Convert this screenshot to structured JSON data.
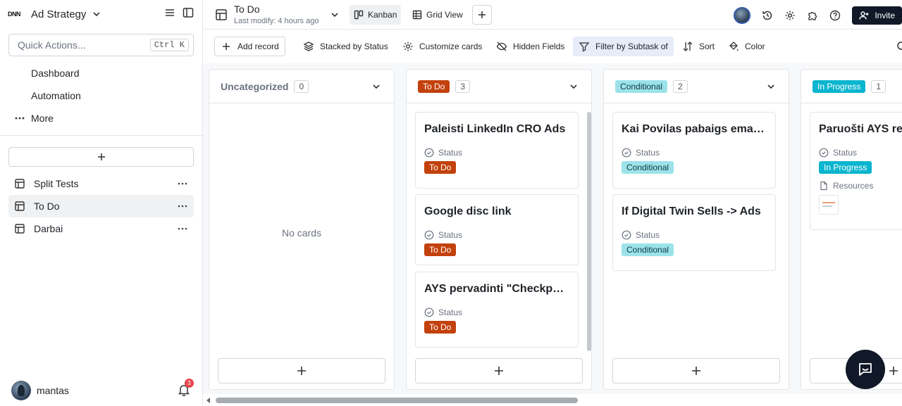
{
  "workspace": {
    "logo_text": "DNN",
    "name": "Ad Strategy"
  },
  "quick_actions": {
    "placeholder": "Quick Actions...",
    "shortcut": "Ctrl K"
  },
  "nav": [
    {
      "label": "Dashboard",
      "icon": "dashboard-icon"
    },
    {
      "label": "Automation",
      "icon": "automation-icon"
    },
    {
      "label": "More",
      "icon": "more-horizontal-icon"
    }
  ],
  "tables": [
    {
      "label": "Split Tests",
      "active": false
    },
    {
      "label": "To Do",
      "active": true
    },
    {
      "label": "Darbai",
      "active": false
    }
  ],
  "user": {
    "name": "mantas",
    "notifications": "3"
  },
  "header": {
    "title": "To Do",
    "subtitle": "Last modify: 4 hours ago"
  },
  "views": [
    {
      "label": "Kanban",
      "active": true
    },
    {
      "label": "Grid View",
      "active": false
    }
  ],
  "invite_label": "Invite",
  "toolbar": {
    "add_record": "Add record",
    "stacked": "Stacked by Status",
    "customize": "Customize cards",
    "hidden": "Hidden Fields",
    "filter": "Filter by Subtask of",
    "sort": "Sort",
    "color": "Color"
  },
  "columns": [
    {
      "title": "Uncategorized",
      "count": "0",
      "empty_text": "No cards",
      "cards": []
    },
    {
      "title": "To Do",
      "count": "3",
      "cards": [
        {
          "title": "Paleisti LinkedIn CRO Ads",
          "field": "Status",
          "value": "To Do"
        },
        {
          "title": "Google disc link",
          "field": "Status",
          "value": "To Do"
        },
        {
          "title": "AYS pervadinti \"Checkpoint\"",
          "field": "Status",
          "value": "To Do"
        }
      ]
    },
    {
      "title": "Conditional",
      "count": "2",
      "cards": [
        {
          "title": "Kai Povilas pabaigs email sekas",
          "field": "Status",
          "value": "Conditional"
        },
        {
          "title": "If Digital Twin Sells -> Ads",
          "field": "Status",
          "value": "Conditional"
        }
      ]
    },
    {
      "title": "In Progress",
      "count": "1",
      "cards": [
        {
          "title": "Paruošti AYS re",
          "field": "Status",
          "value": "In Progress",
          "field2": "Resources"
        }
      ]
    }
  ],
  "colors": {
    "todo": "#c2410c",
    "conditional": "#9be3e9",
    "in_progress": "#0bb5cf",
    "invite_bg": "#111827"
  }
}
